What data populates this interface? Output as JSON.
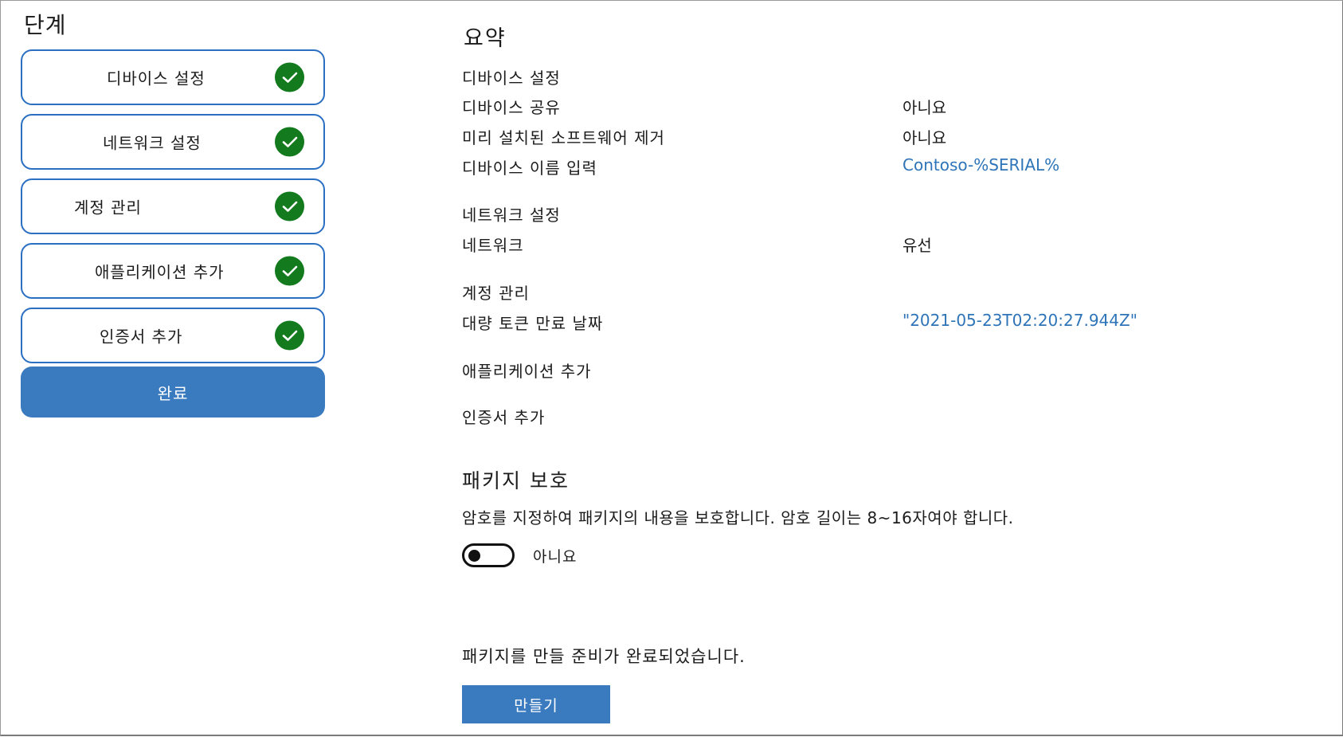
{
  "steps_panel": {
    "title": "단계",
    "steps": [
      {
        "label": "디바이스 설정",
        "status_icon": "check-circle-icon"
      },
      {
        "label": "네트워크 설정",
        "status_icon": "check-circle-icon"
      },
      {
        "label": "계정 관리",
        "status_icon": "check-circle-icon"
      },
      {
        "label": "애플리케이션 추가",
        "status_icon": "check-circle-icon"
      },
      {
        "label": "인증서 추가",
        "status_icon": "check-circle-icon"
      }
    ],
    "finish_label": "완료"
  },
  "summary": {
    "title": "요약",
    "device_settings": {
      "heading": "디바이스 설정",
      "shared_device_label": "디바이스 공유",
      "shared_device_value": "아니요",
      "remove_preinstalled_label": "미리 설치된 소프트웨어 제거",
      "remove_preinstalled_value": "아니요",
      "device_name_label": "디바이스 이름 입력",
      "device_name_value": "Contoso-%SERIAL%"
    },
    "network_settings": {
      "heading": "네트워크 설정",
      "network_label": "네트워크",
      "network_value": "유선"
    },
    "account_management": {
      "heading": "계정 관리",
      "bulk_token_expiry_label": "대량 토큰 만료 날짜",
      "bulk_token_expiry_value": "\"2021-05-23T02:20:27.944Z\""
    },
    "add_applications": {
      "heading": "애플리케이션 추가"
    },
    "add_certificates": {
      "heading": "인증서 추가"
    }
  },
  "package_protection": {
    "title": "패키지 보호",
    "description": "암호를 지정하여 패키지의 내용을 보호합니다. 암호 길이는 8~16자여야 합니다.",
    "toggle_state": "off",
    "toggle_label": "아니요"
  },
  "ready_text": "패키지를 만들 준비가 완료되었습니다.",
  "create_label": "만들기",
  "colors": {
    "accent": "#3a7abf",
    "border": "#2b6fc2",
    "check": "#137a1e",
    "link": "#2e74b8"
  }
}
